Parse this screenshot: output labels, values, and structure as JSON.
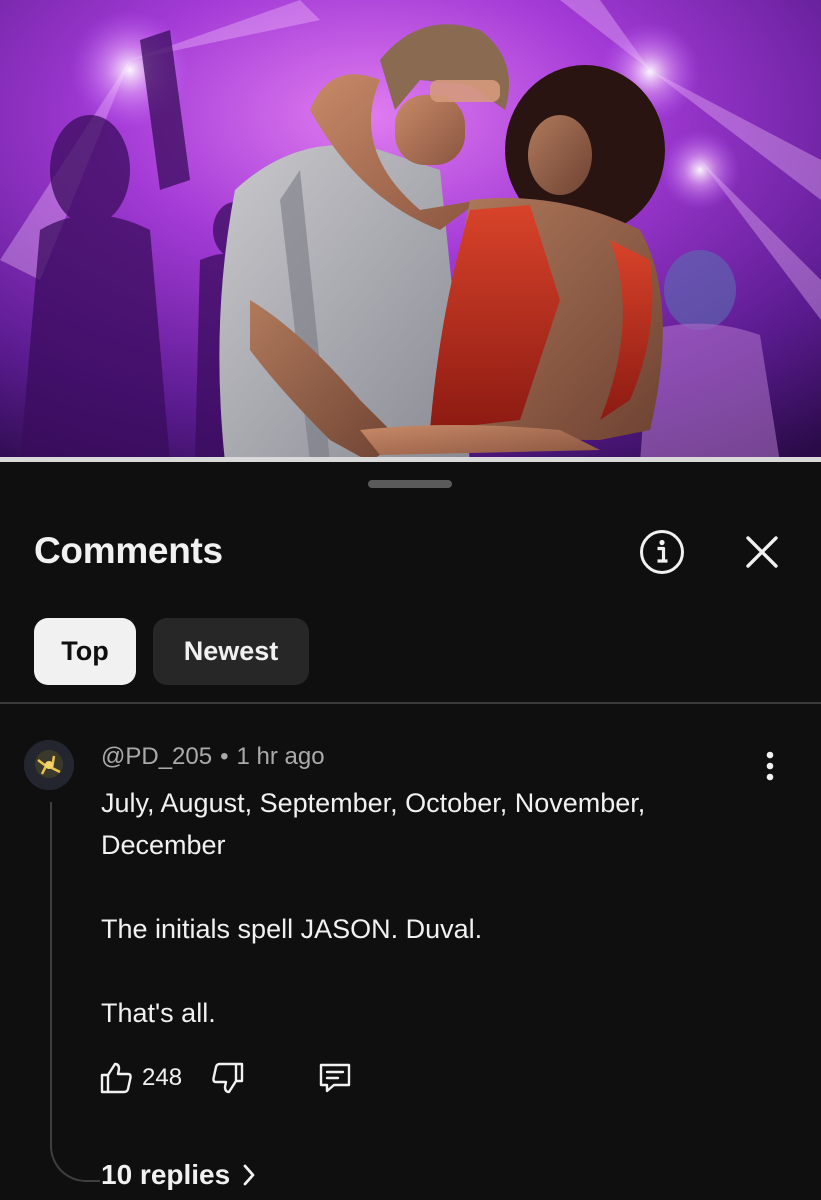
{
  "hero": {
    "alt_icon": "video-thumbnail"
  },
  "comments_panel": {
    "title": "Comments",
    "info_icon": "info-icon",
    "close_icon": "close-icon",
    "sort_tabs": [
      {
        "label": "Top",
        "selected": true
      },
      {
        "label": "Newest",
        "selected": false
      }
    ]
  },
  "comment": {
    "author": "@PD_205",
    "separator": "•",
    "time": "1 hr ago",
    "paragraphs": [
      "July, August, September, October, November, December",
      "The initials spell JASON. Duval.",
      "That's all."
    ],
    "like_count": "248",
    "replies_label": "10 replies"
  },
  "colors": {
    "background": "#0f0f0f",
    "text": "#f1f1f1",
    "secondary_text": "#aaaaaa",
    "chip_selected_bg": "#f1f1f1",
    "chip_bg": "#272727"
  }
}
